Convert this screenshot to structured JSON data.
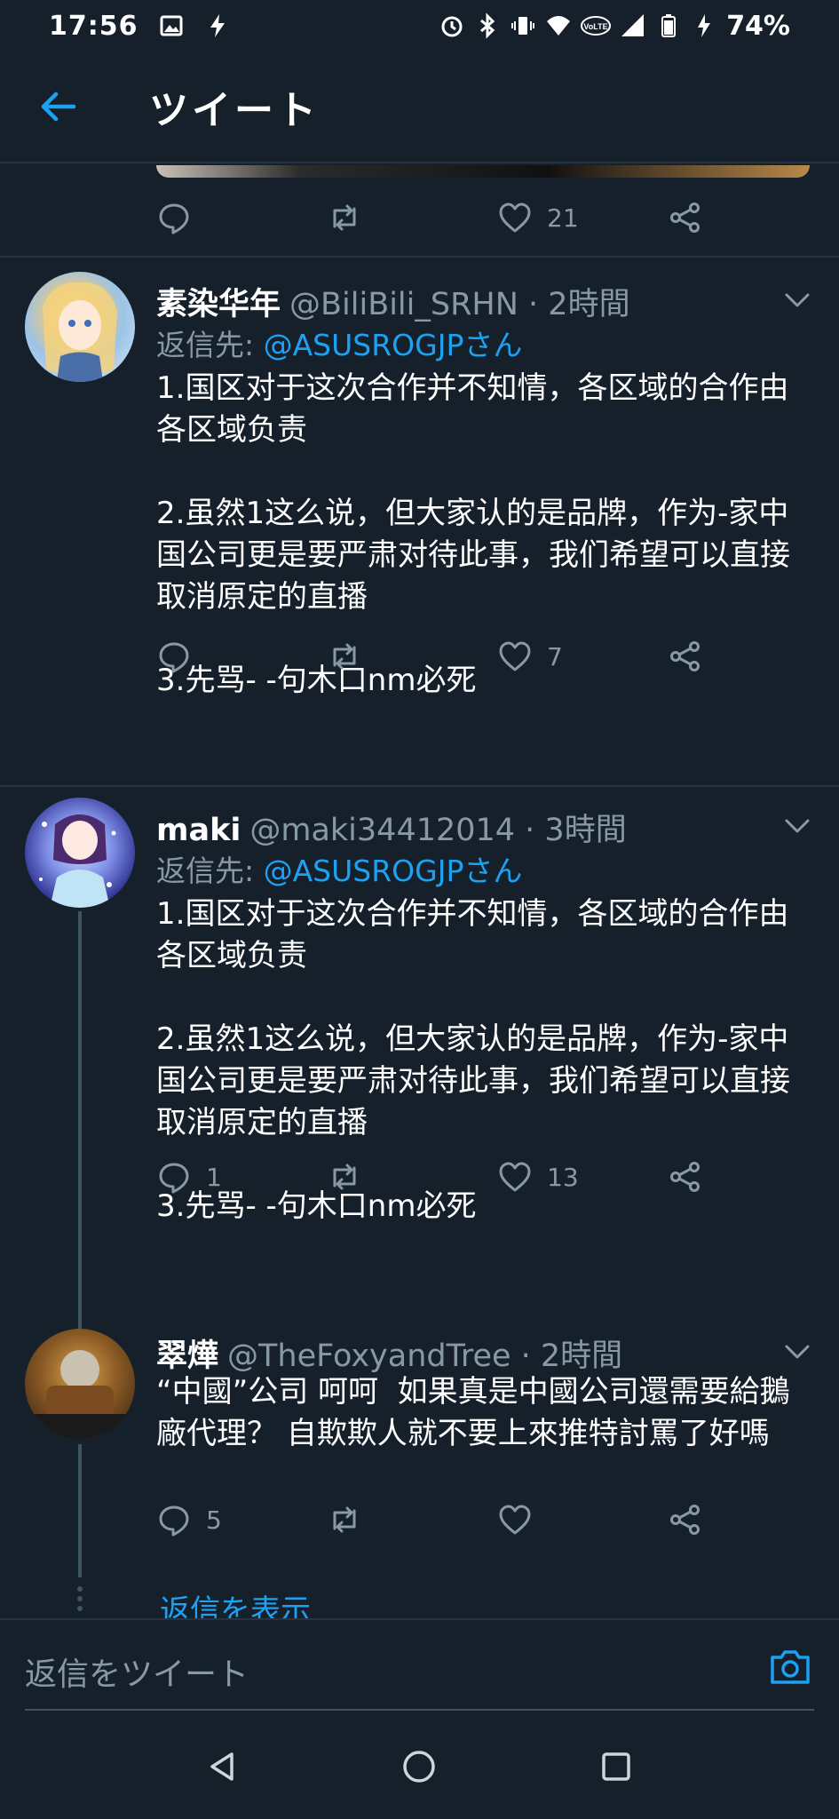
{
  "status_bar": {
    "time": "17:56",
    "volte_label": "VoLTE",
    "battery_percent": "74%"
  },
  "header": {
    "title": "ツイート"
  },
  "prev_tweet_actions": {
    "replies": "",
    "retweets": "",
    "likes": "21"
  },
  "tweets": [
    {
      "name": "素染华年",
      "handle": "@BiliBili_SRHN · 2時間",
      "reply_prefix": "返信先: ",
      "reply_to": "@ASUSROGJPさん",
      "text": "1.国区对于这次合作并不知情，各区域的合作由各区域负责\n\n2.虽然1这么说，但大家认的是品牌，作为-家中国公司更是要严肃对待此事，我们希望可以直接取消原定的直播\n\n3.先骂- -句木口nm必死",
      "replies": "",
      "retweets": "",
      "likes": "7"
    },
    {
      "name": "maki",
      "handle": "@maki34412014 · 3時間",
      "reply_prefix": "返信先: ",
      "reply_to": "@ASUSROGJPさん",
      "text": "1.国区对于这次合作并不知情，各区域的合作由各区域负责\n\n2.虽然1这么说，但大家认的是品牌，作为-家中国公司更是要严肃对待此事，我们希望可以直接取消原定的直播\n\n3.先骂- -句木口nm必死",
      "replies": "1",
      "retweets": "",
      "likes": "13"
    },
    {
      "name": "翠燁",
      "handle": "@TheFoxyandTree · 2時間",
      "text": "“中國”公司 呵呵  如果真是中國公司還需要給鵝廠代理？ 自欺欺人就不要上來推特討罵了好嗎",
      "replies": "5",
      "retweets": "",
      "likes": ""
    }
  ],
  "show_replies": "返信を表示",
  "composer": {
    "placeholder": "返信をツイート"
  },
  "colors": {
    "background": "#15202b",
    "accent": "#1da1f2",
    "secondary_text": "#8899a6",
    "divider": "#263340"
  },
  "icons": {
    "back": "arrow-left-icon",
    "reply": "speech-bubble-icon",
    "retweet": "retweet-arrows-icon",
    "like": "heart-icon",
    "share": "share-nodes-icon",
    "more": "chevron-down-icon",
    "camera": "camera-icon"
  }
}
